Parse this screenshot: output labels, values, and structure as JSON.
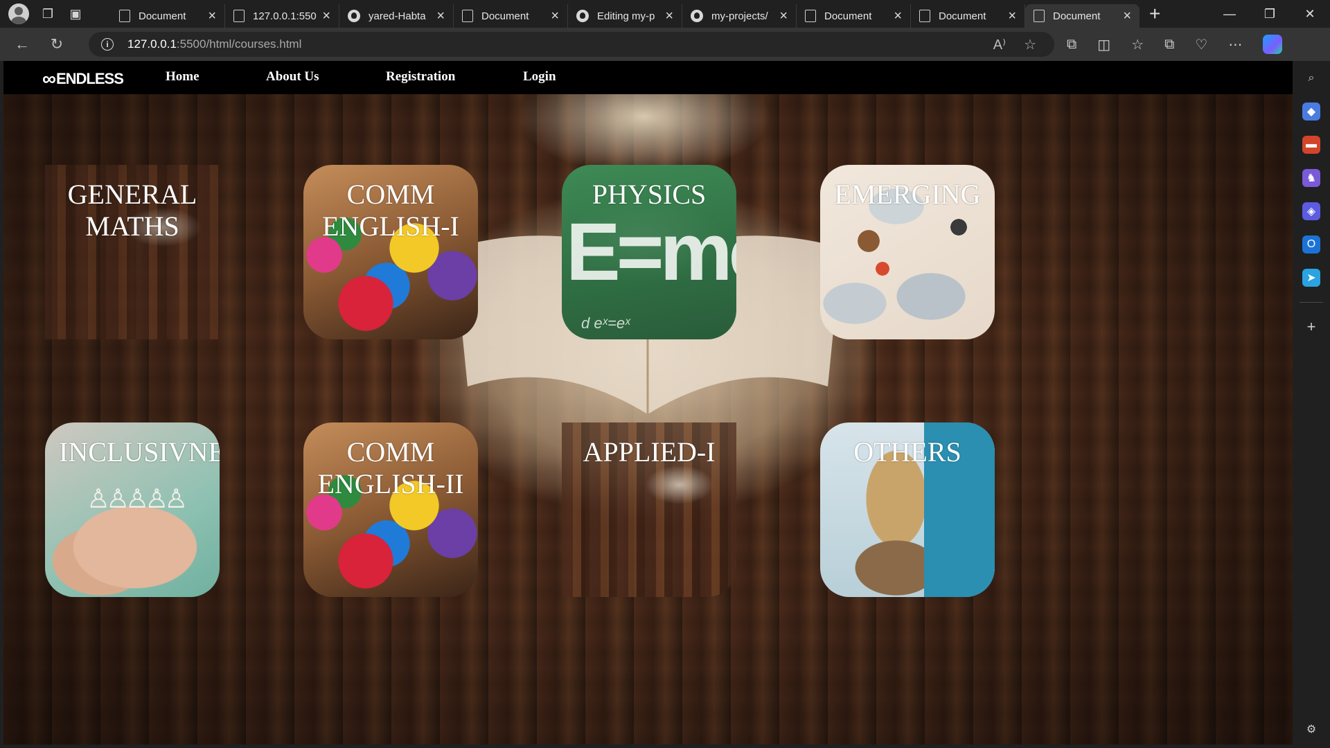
{
  "browser": {
    "tabs": [
      {
        "title": "Document",
        "icon": "page-icon",
        "active": false
      },
      {
        "title": "127.0.0.1:550",
        "icon": "page-icon",
        "active": false
      },
      {
        "title": "yared-Habta",
        "icon": "github-icon",
        "active": false
      },
      {
        "title": "Document",
        "icon": "page-icon",
        "active": false
      },
      {
        "title": "Editing my-p",
        "icon": "github-icon",
        "active": false
      },
      {
        "title": "my-projects/",
        "icon": "github-icon",
        "active": false
      },
      {
        "title": "Document",
        "icon": "page-icon",
        "active": false
      },
      {
        "title": "Document",
        "icon": "page-icon",
        "active": false
      },
      {
        "title": "Document",
        "icon": "page-icon",
        "active": true
      }
    ],
    "url_host": "127.0.0.1",
    "url_path": ":5500/html/courses.html"
  },
  "site": {
    "logo_symbol": "∞",
    "logo_text": "ENDLESS",
    "nav": [
      "Home",
      "About Us",
      "Registration",
      "Login"
    ]
  },
  "courses": [
    {
      "title_line1": "GENERAL",
      "title_line2": "MATHS"
    },
    {
      "title_line1": "COMM",
      "title_line2": "ENGLISH-I"
    },
    {
      "title_line1": "PHYSICS",
      "title_line2": ""
    },
    {
      "title_line1": "EMERGING",
      "title_line2": ""
    },
    {
      "title_line1": "INCLUSIVNE",
      "title_line2": ""
    },
    {
      "title_line1": "COMM",
      "title_line2": "ENGLISH-II"
    },
    {
      "title_line1": "APPLIED-I",
      "title_line2": ""
    },
    {
      "title_line1": "OTHERS",
      "title_line2": ""
    }
  ],
  "physics_art": {
    "formula": "E=mc",
    "small": "d eˣ=eˣ"
  },
  "colors": {
    "nav_bg": "#000000",
    "chrome_bg": "#202020",
    "addr_bg": "#353535"
  }
}
